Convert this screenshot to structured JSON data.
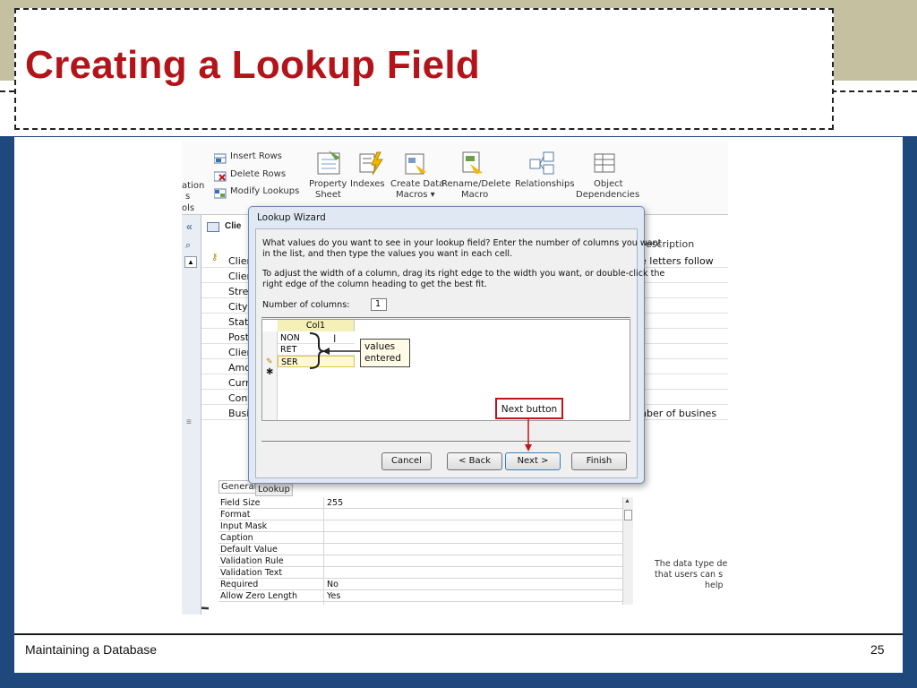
{
  "slide": {
    "title": "Creating a Lookup Field",
    "footer_left": "Maintaining a Database",
    "footer_page": "25"
  },
  "ribbon": {
    "insert_rows": "Insert Rows",
    "delete_rows": "Delete Rows",
    "modify_lookups": "Modify Lookups",
    "left_partial_1": "ation",
    "left_partial_2": "s",
    "left_partial_3": "ols",
    "property_sheet_1": "Property",
    "property_sheet_2": "Sheet",
    "indexes": "Indexes",
    "create_data_macros_1": "Create Data",
    "create_data_macros_2": "Macros ▾",
    "rename_delete_macro_1": "Rename/Delete",
    "rename_delete_macro_2": "Macro",
    "relationships": "Relationships",
    "object_dependencies_1": "Object",
    "object_dependencies_2": "Dependencies"
  },
  "table": {
    "tab_label": "Clie",
    "description_header": "escription",
    "fields": [
      "Clien",
      "Clien",
      "Stree",
      "City",
      "State",
      "Post",
      "Clien",
      "Amo",
      "Curr",
      "Cont",
      "Busi"
    ],
    "desc_row1": "e letters follow",
    "desc_row11": "nber of busines"
  },
  "wizard": {
    "title": "Lookup Wizard",
    "instruction1_l1": "What values do you want to see in your lookup field? Enter the number of columns you want",
    "instruction1_l2": "in the list, and then type the values you want in each cell.",
    "instruction2_l1": "To adjust the width of a column, drag its right edge to the width you want, or double-click the",
    "instruction2_l2": "right edge of the column heading to get the best fit.",
    "num_columns_label": "Number of columns:",
    "num_columns_value": "1",
    "col_header": "Col1",
    "values": [
      "NON",
      "RET",
      "SER"
    ],
    "buttons": {
      "cancel": "Cancel",
      "back": "< Back",
      "next": "Next >",
      "finish": "Finish"
    }
  },
  "callouts": {
    "values_entered_l1": "values",
    "values_entered_l2": "entered",
    "next_button": "Next button"
  },
  "properties": {
    "tab_general": "General",
    "tab_lookup": "Lookup",
    "rows": [
      {
        "name": "Field Size",
        "value": "255"
      },
      {
        "name": "Format",
        "value": ""
      },
      {
        "name": "Input Mask",
        "value": ""
      },
      {
        "name": "Caption",
        "value": ""
      },
      {
        "name": "Default Value",
        "value": ""
      },
      {
        "name": "Validation Rule",
        "value": ""
      },
      {
        "name": "Validation Text",
        "value": ""
      },
      {
        "name": "Required",
        "value": "No"
      },
      {
        "name": "Allow Zero Length",
        "value": "Yes"
      }
    ],
    "side_note_l1": "The data type de",
    "side_note_l2": "that users can s",
    "side_note_l3": "help"
  },
  "colors": {
    "title_red": "#b3141a",
    "slide_blue": "#1f497d",
    "tan": "#c5c0a0",
    "callout_red": "#c0141a"
  }
}
